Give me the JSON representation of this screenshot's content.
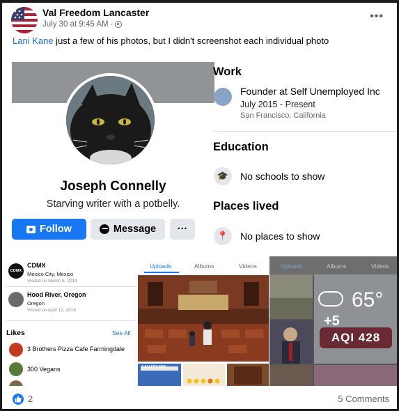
{
  "post": {
    "author": "Val Freedom Lancaster",
    "time": "July 30 at 9:45 AM",
    "time_sep": "·",
    "mention": "Lani Kane",
    "text": " just a few of his photos, but I didn't screenshot each individual photo"
  },
  "profile": {
    "name": "Joseph Connelly",
    "bio": "Starving writer with a potbelly.",
    "follow_label": "Follow",
    "message_label": "Message",
    "more_label": "···",
    "work_title": "Work",
    "work_role": "Founder at Self Unemployed Inc",
    "work_dates": "July 2015 - Present",
    "work_location": "San Francisco, California",
    "education_title": "Education",
    "education_value": "No schools to show",
    "places_title": "Places lived",
    "places_value": "No places to show"
  },
  "checkins": [
    {
      "name": "CDMX",
      "sub": "Mexico City, Mexico",
      "visited": "Visited on March 6, 2019",
      "icon_text": "CDMX"
    },
    {
      "name": "Hood River, Oregon",
      "sub": "Oregon",
      "visited": "Visited on April 12, 2018"
    }
  ],
  "likes": {
    "title": "Likes",
    "see_all": "See All",
    "items": [
      {
        "name": "3 Brothers Pizza Cafe Farmingdale",
        "color": "#c23b22"
      },
      {
        "name": "300 Vegans",
        "color": "#5a7a3a"
      }
    ]
  },
  "gallery_a": {
    "tabs": [
      "Uploads",
      "Albums",
      "Videos"
    ],
    "thumb_label": "GALLERY MEN"
  },
  "gallery_b": {
    "tabs": [
      "Uploads",
      "Albums",
      "Videos"
    ],
    "more_count": "+5",
    "weather_temp": "65°",
    "aqi": "AQI 428"
  },
  "footer": {
    "likes": "2",
    "comments": "5 Comments"
  },
  "colors": {
    "brand": "#1877f2",
    "mention": "#216fdb",
    "secondary_text": "#65676b"
  }
}
